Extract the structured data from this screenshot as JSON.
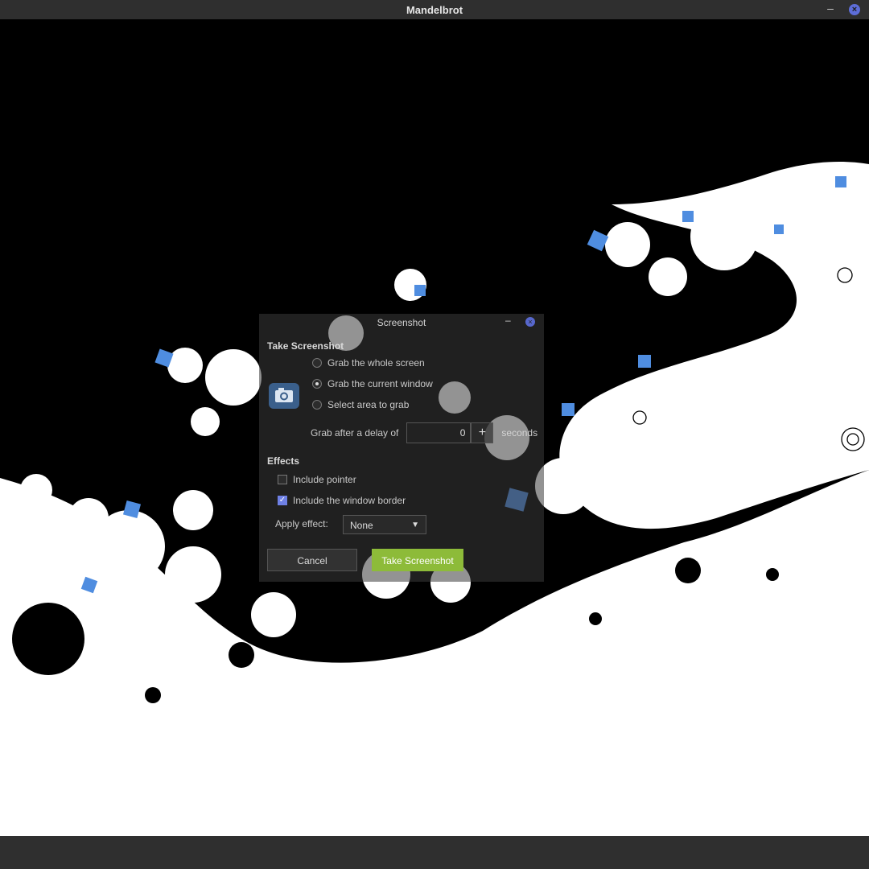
{
  "window": {
    "title": "Mandelbrot",
    "minimize_glyph": "–",
    "close_glyph": "×",
    "accent": "#5d6dd8"
  },
  "dialog": {
    "title": "Screenshot",
    "take_section_label": "Take Screenshot",
    "options": [
      "Grab the whole screen",
      "Grab the current window",
      "Select area to grab"
    ],
    "selected_option_index": 1,
    "delay_label": "Grab after a delay of",
    "delay_value": "0",
    "delay_plus": "+",
    "delay_unit": "seconds",
    "effects_section_label": "Effects",
    "include_pointer_label": "Include pointer",
    "include_pointer_checked": false,
    "include_border_label": "Include the window border",
    "include_border_checked": true,
    "apply_effect_label": "Apply effect:",
    "apply_effect_value": "None",
    "cancel_label": "Cancel",
    "take_label": "Take Screenshot",
    "take_color": "#8dbb39"
  },
  "icons": {
    "camera": "camera-icon",
    "close": "close-icon",
    "minimize": "minimize-icon",
    "dropdown": "chevron-down-icon"
  }
}
